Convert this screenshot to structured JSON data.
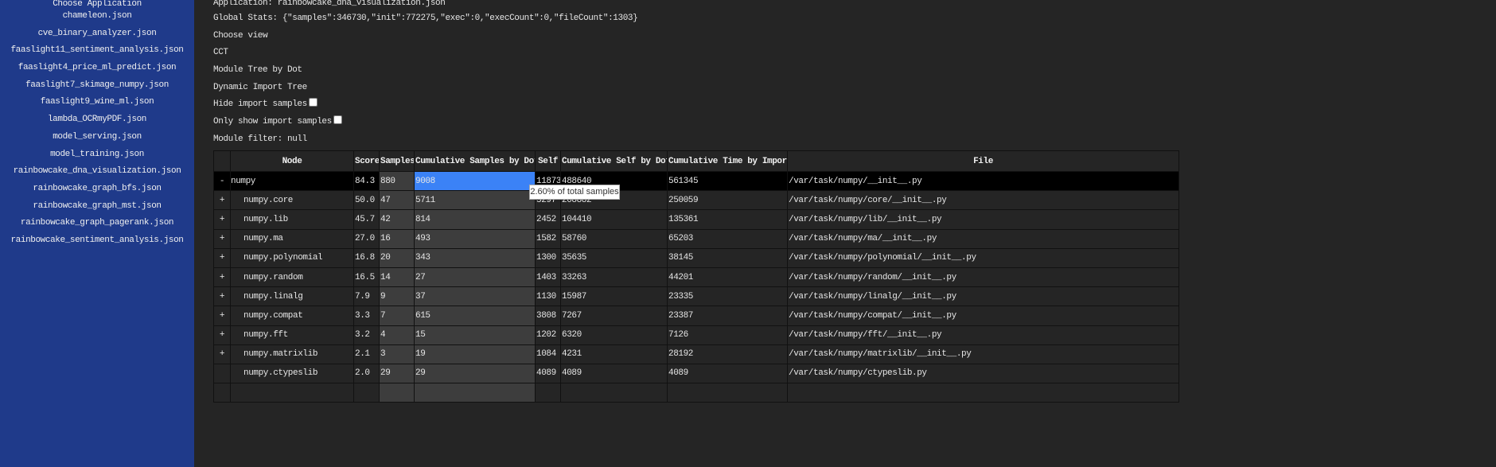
{
  "sidebar": {
    "title": "Choose Application",
    "items": [
      "chameleon.json",
      "cve_binary_analyzer.json",
      "faaslight11_sentiment_analysis.json",
      "faaslight4_price_ml_predict.json",
      "faaslight7_skimage_numpy.json",
      "faaslight9_wine_ml.json",
      "lambda_OCRmyPDF.json",
      "model_serving.json",
      "model_training.json",
      "rainbowcake_dna_visualization.json",
      "rainbowcake_graph_bfs.json",
      "rainbowcake_graph_mst.json",
      "rainbowcake_graph_pagerank.json",
      "rainbowcake_sentiment_analysis.json"
    ]
  },
  "main": {
    "application": "Application: rainbowcake_dna_visualization.json",
    "global_stats": "Global Stats: {\"samples\":346730,\"init\":772275,\"exec\":0,\"execCount\":0,\"fileCount\":1303}",
    "choose_view": "Choose view",
    "views": [
      "CCT",
      "Module Tree by Dot",
      "Dynamic Import Tree"
    ],
    "hide_import": "Hide import samples",
    "only_import": "Only show import samples",
    "module_filter": "Module filter: null"
  },
  "table": {
    "headers": [
      "",
      "Node",
      "Score",
      "Samples",
      "Cumulative Samples by Dot",
      "Self",
      "Cumulative Self by Dot",
      "Cumulative Time by Import",
      "File"
    ],
    "rows": [
      [
        "-",
        "numpy",
        "84.3",
        "880",
        "9008",
        "11873",
        "488640",
        "561345",
        "/var/task/numpy/__init__.py"
      ],
      [
        "+",
        "numpy.core",
        "50.0",
        "47",
        "5711",
        "5297",
        "208882",
        "250059",
        "/var/task/numpy/core/__init__.py"
      ],
      [
        "+",
        "numpy.lib",
        "45.7",
        "42",
        "814",
        "2452",
        "104410",
        "135361",
        "/var/task/numpy/lib/__init__.py"
      ],
      [
        "+",
        "numpy.ma",
        "27.0",
        "16",
        "493",
        "1582",
        "58760",
        "65203",
        "/var/task/numpy/ma/__init__.py"
      ],
      [
        "+",
        "numpy.polynomial",
        "16.8",
        "20",
        "343",
        "1300",
        "35635",
        "38145",
        "/var/task/numpy/polynomial/__init__.py"
      ],
      [
        "+",
        "numpy.random",
        "16.5",
        "14",
        "27",
        "1403",
        "33263",
        "44201",
        "/var/task/numpy/random/__init__.py"
      ],
      [
        "+",
        "numpy.linalg",
        "7.9",
        "9",
        "37",
        "1130",
        "15987",
        "23335",
        "/var/task/numpy/linalg/__init__.py"
      ],
      [
        "+",
        "numpy.compat",
        "3.3",
        "7",
        "615",
        "3808",
        "7267",
        "23387",
        "/var/task/numpy/compat/__init__.py"
      ],
      [
        "+",
        "numpy.fft",
        "3.2",
        "4",
        "15",
        "1202",
        "6320",
        "7126",
        "/var/task/numpy/fft/__init__.py"
      ],
      [
        "+",
        "numpy.matrixlib",
        "2.1",
        "3",
        "19",
        "1084",
        "4231",
        "28192",
        "/var/task/numpy/matrixlib/__init__.py"
      ],
      [
        "",
        "numpy.ctypeslib",
        "2.0",
        "29",
        "29",
        "4089",
        "4089",
        "4089",
        "/var/task/numpy/ctypeslib.py"
      ]
    ]
  },
  "tooltip": "2.60% of total samples"
}
